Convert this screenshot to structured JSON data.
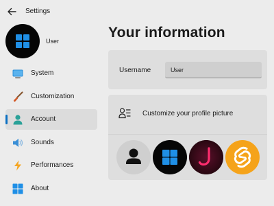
{
  "app": {
    "title": "Settings"
  },
  "user": {
    "name": "User"
  },
  "nav": {
    "items": [
      {
        "label": "System",
        "icon": "monitor-icon",
        "active": false
      },
      {
        "label": "Customization",
        "icon": "brush-icon",
        "active": false
      },
      {
        "label": "Account",
        "icon": "person-icon",
        "active": true
      },
      {
        "label": "Sounds",
        "icon": "speaker-icon",
        "active": false
      },
      {
        "label": "Performances",
        "icon": "lightning-icon",
        "active": false
      },
      {
        "label": "About",
        "icon": "windows-logo-icon",
        "active": false
      }
    ]
  },
  "main": {
    "title": "Your information",
    "username": {
      "label": "Username",
      "value": "User"
    },
    "picture": {
      "label": "Customize your profile picture",
      "options": [
        "default-person-avatar",
        "windows-logo-avatar",
        "jetbrains-logo-avatar",
        "svelte-logo-avatar"
      ]
    }
  },
  "colors": {
    "accent": "#0a6fc2",
    "background": "#ececec",
    "card": "#dedede"
  }
}
